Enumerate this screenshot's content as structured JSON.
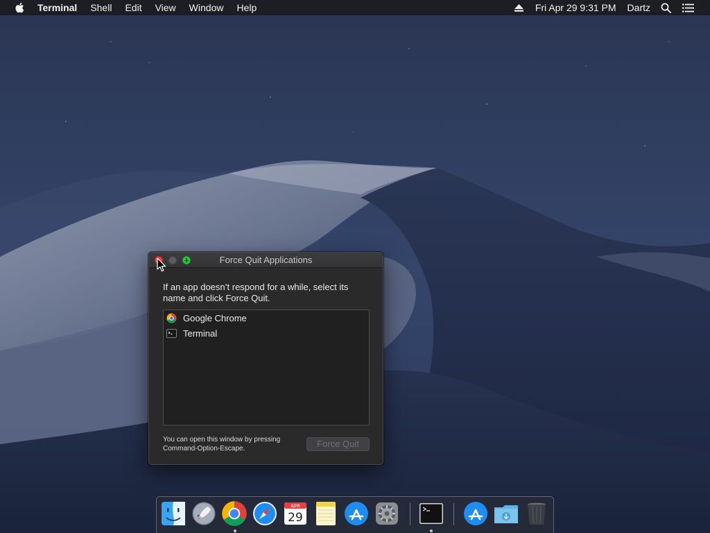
{
  "menubar": {
    "app_name": "Terminal",
    "menus": [
      "Shell",
      "Edit",
      "View",
      "Window",
      "Help"
    ],
    "icons": {
      "apple": "apple-logo-icon",
      "eject": "eject-icon",
      "search": "spotlight-search-icon",
      "notifications": "notification-center-icon"
    },
    "clock": "Fri Apr 29  9:31 PM",
    "user": "Dartz"
  },
  "force_quit_window": {
    "title": "Force Quit Applications",
    "description": "If an app doesn’t respond for a while, select its name and click Force Quit.",
    "apps": [
      {
        "name": "Google Chrome",
        "icon": "chrome-icon"
      },
      {
        "name": "Terminal",
        "icon": "terminal-icon"
      }
    ],
    "hint": "You can open this window by pressing Command-Option-Escape.",
    "force_quit_label": "Force Quit",
    "force_quit_enabled": false
  },
  "dock": {
    "apps": [
      {
        "icon": "finder-icon",
        "running": true
      },
      {
        "icon": "launchpad-icon",
        "running": false
      },
      {
        "icon": "chrome-icon",
        "running": false
      },
      {
        "icon": "safari-icon",
        "running": false
      },
      {
        "icon": "calendar-icon",
        "running": false,
        "month": "APR",
        "day": "29"
      },
      {
        "icon": "notes-icon",
        "running": false
      },
      {
        "icon": "app-store-icon",
        "running": false
      },
      {
        "icon": "system-preferences-icon",
        "running": false
      },
      {
        "icon": "terminal-icon",
        "running": true
      },
      {
        "icon": "app-store-downloads-icon",
        "running": false
      },
      {
        "icon": "downloads-folder-icon",
        "running": false
      },
      {
        "icon": "trash-icon",
        "running": false
      }
    ]
  },
  "colors": {
    "close": "#e0443e",
    "zoom": "#2ec83f",
    "window_bg": "#2a2a2b",
    "wallpaper_sky": "#2b3957"
  }
}
